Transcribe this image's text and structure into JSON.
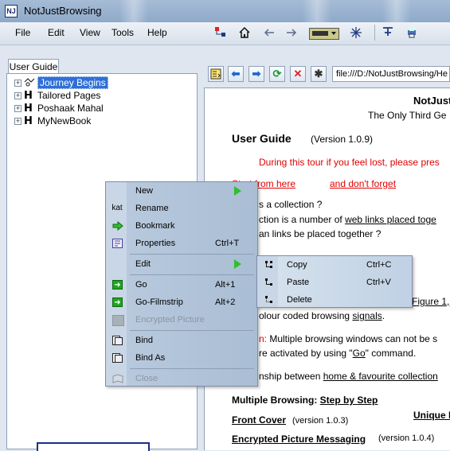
{
  "window": {
    "title": "NotJustBrowsing",
    "app_icon_text": "NJ"
  },
  "menu": [
    "File",
    "Edit",
    "View",
    "Tools",
    "Help"
  ],
  "left": {
    "tab": "User Guide",
    "tree": [
      {
        "label": "Journey Begins",
        "selected": true
      },
      {
        "label": "Tailored Pages"
      },
      {
        "label": "Poshaak Mahal"
      },
      {
        "label": "MyNewBook"
      }
    ]
  },
  "address": "file:///D:/NotJustBrowsing/He",
  "doc": {
    "brand1": "NotJust",
    "brand2": "The Only Third Ge",
    "heading": "User Guide",
    "version": "(Version 1.0.9)",
    "tour_note": "During this tour if you feel lost, please pres",
    "start_from": "Start from here",
    "dont_forget": "and don't forget",
    "q1": "s a collection ?",
    "q1a_pre": "ction is a number of ",
    "q1a_link": "web links placed toge",
    "q2": "an links be placed together ?",
    "fig_ref": "Figure 1,",
    "signals_pre": "olour coded browsing ",
    "signals_link": "signals",
    "signals_end": ".",
    "note_red": "n:",
    "note_text": " Multiple browsing windows can not be s",
    "go_pre": "re activated by using \"",
    "go_link": "Go",
    "go_post": "\" command.",
    "rel_pre": "nship between ",
    "rel_link": "home & favourite collection",
    "multi_b": "Multiple Browsing: ",
    "multi_link": "Step by Step",
    "unique": "Unique F",
    "front_cover": "Front Cover",
    "front_ver": "(version 1.0.3)",
    "enc_pic": "Encrypted Picture Messaging",
    "enc_ver": "(version 1.0.4)"
  },
  "context_menu": {
    "items": [
      {
        "label": "New",
        "icon": "blank",
        "submenu": true
      },
      {
        "label": "Rename",
        "icon": "kat-text-icon",
        "icon_text": "kat"
      },
      {
        "label": "Bookmark",
        "icon": "green-arrow-icon"
      },
      {
        "label": "Properties",
        "icon": "properties-icon",
        "shortcut": "Ctrl+T"
      },
      {
        "label": "Edit",
        "icon": "blank",
        "submenu": true
      },
      {
        "label": "Go",
        "icon": "go-icon",
        "shortcut": "Alt+1"
      },
      {
        "label": "Go-Filmstrip",
        "icon": "go-filmstrip-icon",
        "shortcut": "Alt+2"
      },
      {
        "label": "Encrypted Picture",
        "icon": "encrypted-picture-icon",
        "disabled": true
      },
      {
        "label": "Bind",
        "icon": "bind-icon"
      },
      {
        "label": "Bind As",
        "icon": "bind-as-icon"
      },
      {
        "label": "Close",
        "icon": "close-book-icon",
        "disabled": true
      }
    ]
  },
  "submenu": {
    "items": [
      {
        "label": "Copy",
        "shortcut": "Ctrl+C"
      },
      {
        "label": "Paste",
        "shortcut": "Ctrl+V"
      },
      {
        "label": "Delete"
      }
    ]
  },
  "toolbar_icons": [
    "tree-icon",
    "home-icon",
    "back-arrow-icon",
    "forward-arrow-icon",
    "keyboard-dropdown-icon",
    "star-icon",
    "pin-icon",
    "print-icon"
  ],
  "nav_icons": [
    "bookmark-add-icon",
    "back-icon",
    "forward-icon",
    "refresh-icon",
    "stop-icon",
    "gear-icon"
  ],
  "colors": {
    "selection": "#2f6fd6",
    "link_red": "#e00000",
    "accent_green": "#2fbf2f"
  }
}
